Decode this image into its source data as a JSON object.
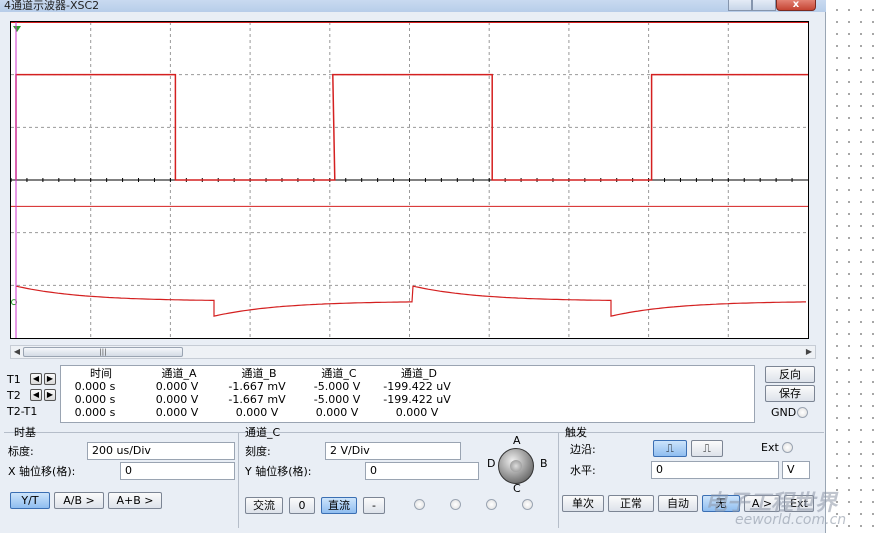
{
  "window": {
    "title": "4通道示波器-XSC2",
    "close_label": "x"
  },
  "scope": {
    "trace_color": "#d42020",
    "axis_color": "#000000",
    "grid_color": "#9a9a9a"
  },
  "scrollbar": {
    "thumb_label": "|||"
  },
  "readout": {
    "headers": [
      "时间",
      "通道_A",
      "通道_B",
      "通道_C",
      "通道_D"
    ],
    "rows": [
      {
        "label": "T1",
        "values": [
          "0.000 s",
          "0.000 V",
          "-1.667 mV",
          "-5.000 V",
          "-199.422 uV"
        ]
      },
      {
        "label": "T2",
        "values": [
          "0.000 s",
          "0.000 V",
          "-1.667 mV",
          "-5.000 V",
          "-199.422 uV"
        ]
      },
      {
        "label": "T2-T1",
        "values": [
          "0.000 s",
          "0.000 V",
          "0.000 V",
          "0.000 V",
          "0.000 V"
        ]
      }
    ]
  },
  "side_buttons": {
    "reverse": "反向",
    "save": "保存",
    "gnd": "GND"
  },
  "timebase": {
    "title": "时基",
    "scale_label": "标度:",
    "scale_value": "200 us/Div",
    "xpos_label": "X 轴位移(格):",
    "xpos_value": "0",
    "buttons": [
      "Y/T",
      "A/B >",
      "A+B >"
    ]
  },
  "channel": {
    "title": "通道_C",
    "scale_label": "刻度:",
    "scale_value": "2  V/Div",
    "ypos_label": "Y 轴位移(格):",
    "ypos_value": "0",
    "buttons": [
      "交流",
      "0",
      "直流",
      "-"
    ],
    "selector_letters": [
      "A",
      "B",
      "C",
      "D"
    ]
  },
  "trigger": {
    "title": "触发",
    "edge_label": "边沿:",
    "ext_label": "Ext",
    "level_label": "水平:",
    "level_value": "0",
    "level_unit": "V",
    "mode_buttons": [
      "单次",
      "正常",
      "自动",
      "无",
      "A >",
      "Ext"
    ]
  },
  "watermark": {
    "text": "电子工程世界",
    "sub": "eeworld.com.cn"
  }
}
